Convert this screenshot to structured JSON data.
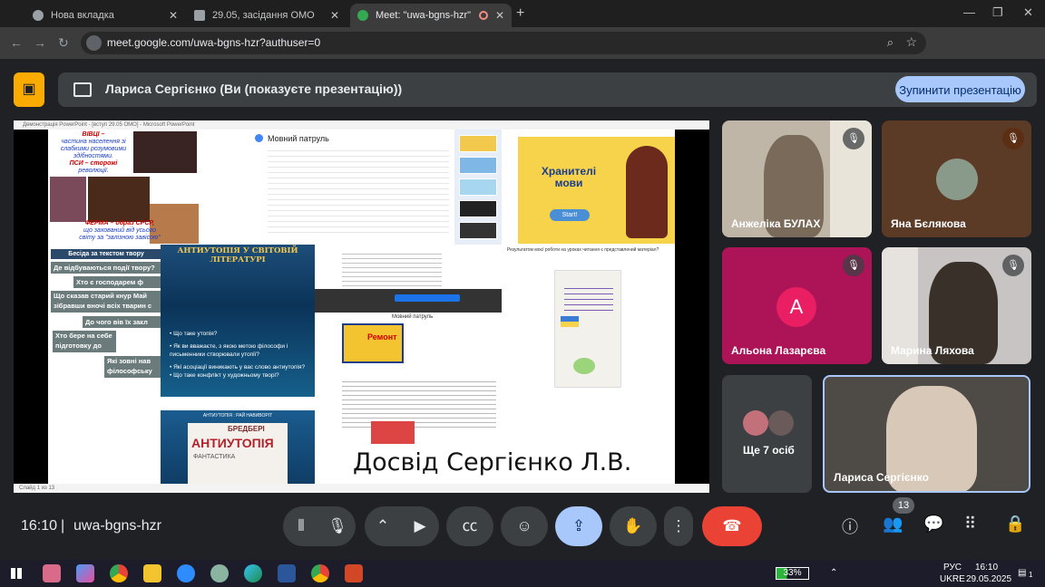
{
  "browser": {
    "tabs": [
      {
        "label": "Нова вкладка"
      },
      {
        "label": "29.05, засідання ОМО"
      },
      {
        "label": "Meet: \"uwa-bgns-hzr\""
      }
    ],
    "url": "meet.google.com/uwa-bgns-hzr?authuser=0",
    "profile_initial": "Л"
  },
  "banner": {
    "text": "Лариса Сергієнко (Ви (показуєте презентацію))",
    "stop_label": "Зупинити презентацію"
  },
  "presentation": {
    "window_title": "Демонстрація PowerPoint - [вступ 29.05 ОМО] - Microsoft PowerPoint",
    "status": "Слайд 1 из 13",
    "poster_lines": [
      "ВІВЦІ –",
      "частина населення зі",
      "слабкими розумовими",
      "здібностями.",
      "ПСИ – сторожі",
      "революції.",
      "ФЕРМА – образ СРСР,",
      "що захований від усього",
      "світу за \"залізною завісою\""
    ],
    "essay_head": "Бесіда за текстом твору",
    "essay_lines": [
      "Де відбуваються події твору?",
      "Хто є господарем ф",
      "Що сказав старий кнур Май зібравши вночі всіх тварин с",
      "До чого вів їх закл",
      "Хто бере на себе підготовку до повстання?",
      "Які зовні нав філософську с"
    ],
    "anti1_title": "АНТИУТОПІЯ У СВІТОВІЙ ЛІТЕРАТУРІ",
    "anti1_bullets": [
      "Що таке утопія?",
      "Як ви вважаєте, з якою метою філософи і письменники створювали утопії?",
      "Які асоціації виникають у вас слово антиутопія?",
      "Що таке конфлікт у художньому творі?"
    ],
    "anti2_title": "АНТИУТОПІЯ : РАЙ НАВИВОРІТ",
    "wordcloud": [
      "БРЕДБЕРІ",
      "АНТИУТОПІЯ",
      "ФАНТАСТИКА"
    ],
    "doc_title": "Мовний патруль",
    "keepers_title": "Хранителі мови",
    "keepers_start": "Start!",
    "ad_banner": "Ремонт",
    "ad_caption": "Мовний патруль",
    "report_head": "Результатом моєї роботи на уроках читання є представлений матеріал?",
    "signature": "Досвід Сергієнко Л.В."
  },
  "participants": [
    {
      "name": "Анжеліка БУЛАХ",
      "muted": true
    },
    {
      "name": "Яна Бєлякова",
      "muted": true
    },
    {
      "name": "Альона Лазарєва",
      "muted": true,
      "initial": "А"
    },
    {
      "name": "Марина Ляхова",
      "muted": true
    },
    {
      "name": "Ще 7 осіб"
    },
    {
      "name": "Лариса Сергієнко"
    }
  ],
  "controls": {
    "time": "16:10",
    "separator": "|",
    "meeting_code": "uwa-bgns-hzr",
    "participants_count": "13"
  },
  "taskbar": {
    "battery": "33%",
    "lang_1": "РУС",
    "lang_2": "UKRE",
    "time": "16:10",
    "date": "29.05.2025",
    "notif": "1"
  },
  "colors": {
    "accent": "#a8c7fa",
    "end_call": "#ea4335",
    "present_warning": "#f9ab00",
    "surface": "#202124",
    "tile_pink": "#ad1457"
  }
}
